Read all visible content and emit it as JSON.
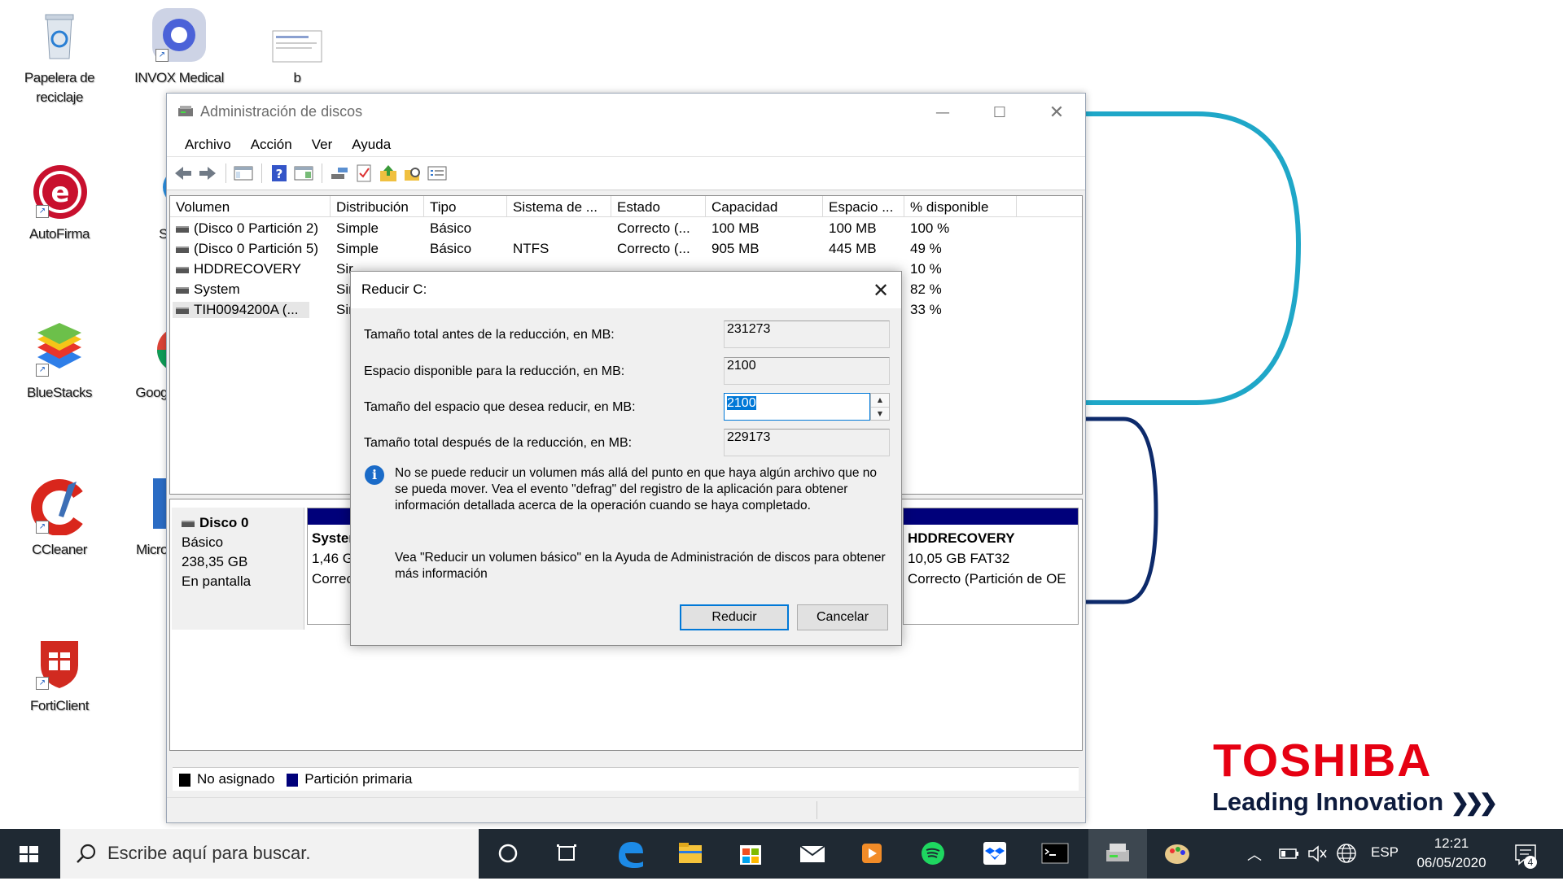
{
  "desktop": {
    "icons": [
      {
        "label": "Papelera de reciclaje",
        "icon": "recycle-bin-icon"
      },
      {
        "label": "INVOX Medical",
        "icon": "invox-medical-icon"
      },
      {
        "label": "b",
        "icon": "document-thumbnail-icon"
      },
      {
        "label": "AutoFirma",
        "icon": "autofirma-icon"
      },
      {
        "label": "S",
        "icon": "partial-app-icon"
      },
      {
        "label": "BlueStacks",
        "icon": "bluestacks-icon"
      },
      {
        "label": "Goog",
        "icon": "google-chrome-icon"
      },
      {
        "label": "CCleaner",
        "icon": "ccleaner-icon"
      },
      {
        "label": "Micro",
        "icon": "microsoft-app-icon"
      },
      {
        "label": "FortiClient",
        "icon": "forticlient-icon"
      }
    ]
  },
  "window": {
    "title": "Administración de discos",
    "menu": [
      "Archivo",
      "Acción",
      "Ver",
      "Ayuda"
    ],
    "columns": [
      "Volumen",
      "Distribución",
      "Tipo",
      "Sistema de ...",
      "Estado",
      "Capacidad",
      "Espacio ...",
      "% disponible"
    ],
    "rows": [
      {
        "volumen": "(Disco 0 Partición 2)",
        "distribucion": "Simple",
        "tipo": "Básico",
        "sistema": "",
        "estado": "Correcto (...",
        "capacidad": "100 MB",
        "espacio": "100 MB",
        "disponible": "100 %"
      },
      {
        "volumen": "(Disco 0 Partición 5)",
        "distribucion": "Simple",
        "tipo": "Básico",
        "sistema": "NTFS",
        "estado": "Correcto (...",
        "capacidad": "905 MB",
        "espacio": "445 MB",
        "disponible": "49 %"
      },
      {
        "volumen": "HDDRECOVERY",
        "distribucion": "Sir",
        "tipo": "",
        "sistema": "",
        "estado": "",
        "capacidad": "",
        "espacio": "",
        "disponible": "10 %"
      },
      {
        "volumen": "System",
        "distribucion": "Sir",
        "tipo": "",
        "sistema": "",
        "estado": "",
        "capacidad": "",
        "espacio": "",
        "disponible": "82 %"
      },
      {
        "volumen": "TIH0094200A (...",
        "distribucion": "Sir",
        "tipo": "",
        "sistema": "",
        "estado": "",
        "capacidad": "",
        "espacio": "",
        "disponible": "33 %"
      }
    ],
    "disk": {
      "name": "Disco 0",
      "type": "Básico",
      "size": "238,35 GB",
      "status": "En pantalla"
    },
    "partition_left": {
      "name": "Syster",
      "line2": "1,46 G",
      "line3": "Correc"
    },
    "partition_right": {
      "name": "HDDRECOVERY",
      "line2": "10,05 GB FAT32",
      "line3": "Correcto (Partición de OE"
    },
    "legend": {
      "unallocated": "No asignado",
      "primary": "Partición primaria"
    },
    "colors": {
      "primary_partition": "#00007a",
      "unallocated": "#000000"
    }
  },
  "dialog": {
    "title": "Reducir C:",
    "fields": [
      {
        "label": "Tamaño total antes de la reducción, en MB:",
        "value": "231273"
      },
      {
        "label": "Espacio disponible para la reducción, en MB:",
        "value": "2100"
      },
      {
        "label": "Tamaño del espacio que desea reducir, en MB:",
        "value": "2100"
      },
      {
        "label": "Tamaño total después de la reducción, en MB:",
        "value": "229173"
      }
    ],
    "info": "No se puede reducir un volumen más allá del punto en que haya algún archivo que no se pueda mover. Vea el evento \"defrag\" del registro de la aplicación para obtener información detallada acerca de la operación cuando se haya completado.",
    "help": "Vea \"Reducir un volumen básico\"  en la Ayuda de Administración de discos para obtener más información",
    "buttons": {
      "ok": "Reducir",
      "cancel": "Cancelar"
    }
  },
  "branding": {
    "brand": "TOSHIBA",
    "tagline": "Leading Innovation",
    "brand_color": "#e60012"
  },
  "taskbar": {
    "search_placeholder": "Escribe aquí para buscar.",
    "language": "ESP",
    "time": "12:21",
    "date": "06/05/2020",
    "notifications": "4"
  }
}
